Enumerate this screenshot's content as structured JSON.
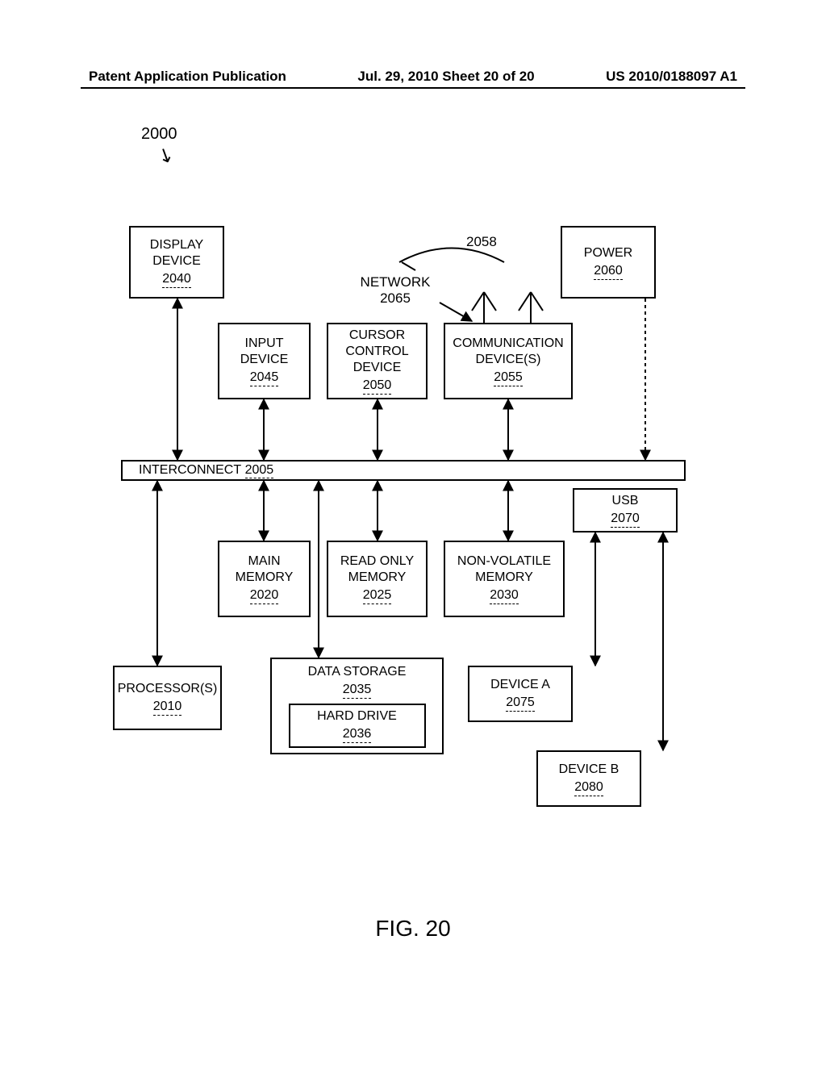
{
  "header": {
    "left": "Patent Application Publication",
    "mid": "Jul. 29, 2010  Sheet 20 of 20",
    "right": "US 2010/0188097 A1"
  },
  "fig_ref": "2000",
  "network": {
    "label": "NETWORK",
    "ref": "2065",
    "antenna_ref": "2058"
  },
  "boxes": {
    "display": {
      "l1": "DISPLAY",
      "l2": "DEVICE",
      "ref": "2040"
    },
    "power": {
      "l1": "POWER",
      "ref": "2060"
    },
    "input": {
      "l1": "INPUT",
      "l2": "DEVICE",
      "ref": "2045"
    },
    "cursor": {
      "l1": "CURSOR",
      "l2": "CONTROL",
      "l3": "DEVICE",
      "ref": "2050"
    },
    "comm": {
      "l1": "COMMUNICATION",
      "l2": "DEVICE(S)",
      "ref": "2055"
    },
    "interconnect": {
      "label": "INTERCONNECT",
      "ref": "2005"
    },
    "usb": {
      "l1": "USB",
      "ref": "2070"
    },
    "mainmem": {
      "l1": "MAIN",
      "l2": "MEMORY",
      "ref": "2020"
    },
    "rom": {
      "l1": "READ ONLY",
      "l2": "MEMORY",
      "ref": "2025"
    },
    "nvm": {
      "l1": "NON-VOLATILE",
      "l2": "MEMORY",
      "ref": "2030"
    },
    "proc": {
      "l1": "PROCESSOR(S)",
      "ref": "2010"
    },
    "datastor": {
      "l1": "DATA STORAGE",
      "ref": "2035"
    },
    "hdd": {
      "l1": "HARD DRIVE",
      "ref": "2036"
    },
    "deva": {
      "l1": "DEVICE A",
      "ref": "2075"
    },
    "devb": {
      "l1": "DEVICE B",
      "ref": "2080"
    }
  },
  "figure_caption": "FIG. 20"
}
